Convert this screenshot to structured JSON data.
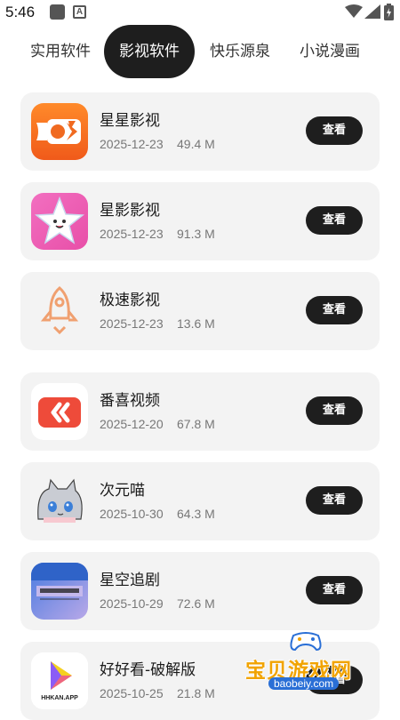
{
  "status_bar": {
    "time": "5:46"
  },
  "tabs": [
    {
      "label": "实用软件",
      "active": false
    },
    {
      "label": "影视软件",
      "active": true
    },
    {
      "label": "快乐源泉",
      "active": false
    },
    {
      "label": "小说漫画",
      "active": false
    }
  ],
  "apps": [
    {
      "name": "星星影视",
      "date": "2025-12-23",
      "size": "49.4 M",
      "button": "查看",
      "icon": "video-camera-orange-icon"
    },
    {
      "name": "星影影视",
      "date": "2025-12-23",
      "size": "91.3 M",
      "button": "查看",
      "icon": "star-pink-icon"
    },
    {
      "name": "极速影视",
      "date": "2025-12-23",
      "size": "13.6 M",
      "button": "查看",
      "icon": "rocket-icon"
    },
    {
      "name": "番喜视频",
      "date": "2025-12-20",
      "size": "67.8 M",
      "button": "查看",
      "icon": "play-red-icon"
    },
    {
      "name": "次元喵",
      "date": "2025-10-30",
      "size": "64.3 M",
      "button": "查看",
      "icon": "anime-cat-icon"
    },
    {
      "name": "星空追剧",
      "date": "2025-10-29",
      "size": "72.6 M",
      "button": "查看",
      "icon": "starry-sky-icon"
    },
    {
      "name": "好好看-破解版",
      "date": "2025-10-25",
      "size": "21.8 M",
      "button": "查看",
      "icon": "hhkan-play-icon",
      "icon_text": "HHKAN.APP"
    }
  ],
  "watermark": {
    "text": "宝贝游戏网",
    "url": "baobeiy.com"
  },
  "colors": {
    "accent": "#1e1e1e",
    "card_bg": "#f3f3f3",
    "meta_text": "#777777"
  }
}
